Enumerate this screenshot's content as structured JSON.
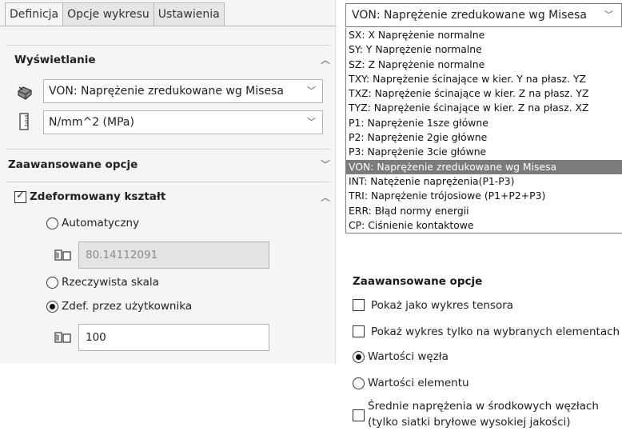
{
  "tabs": [
    "Definicja",
    "Opcje wykresu",
    "Ustawienia"
  ],
  "display": {
    "title": "Wyświetlanie",
    "component": "VON: Naprężenie zredukowane wg Misesa",
    "units": "N/mm^2 (MPa)"
  },
  "advanced_collapsed": {
    "title": "Zaawansowane opcje"
  },
  "deformed": {
    "title": "Zdeformowany kształt",
    "checked": true,
    "auto_label": "Automatyczny",
    "auto_value": "80.14112091",
    "true_scale_label": "Rzeczywista skala",
    "user_label": "Zdef. przez użytkownika",
    "user_value": "100"
  },
  "list": {
    "selected_display": "VON: Naprężenie zredukowane wg Misesa",
    "items": [
      "SX: X Naprężenie normalne",
      "SY: Y Naprężenie normalne",
      "SZ: Z Naprężenie normalne",
      "TXY: Naprężenie ścinające w kier. Y na płasz. YZ",
      "TXZ: Naprężenie ścinające w kier. Z na płasz. YZ",
      "TYZ: Naprężenie ścinające w kier. Z na płasz. XZ",
      "P1: Naprężenie 1sze główne",
      "P2: Naprężenie 2gie główne",
      "P3: Naprężenie 3cie główne",
      "VON: Naprężenie zredukowane wg Misesa",
      "INT: Natężenie naprężenia(P1-P3)",
      "TRI: Naprężenie trójosiowe (P1+P2+P3)",
      "ERR:   Błąd normy energii",
      "CP: Ciśnienie kontaktowe"
    ],
    "selected_index": 9
  },
  "advanced_options": {
    "title": "Zaawansowane opcje",
    "tensor_label": "Pokaż jako wykres tensora",
    "selected_only_label": "Pokaż wykres tylko na wybranych elementach",
    "node_values_label": "Wartości węzła",
    "element_values_label": "Wartości elementu",
    "average_label_1": "Średnie naprężenia w środkowych węzłach",
    "average_label_2": "(tylko siatki bryłowe wysokiej jakości)"
  },
  "colors": {
    "selected_bg": "#7b7b7b",
    "panel_bg": "#f5f5f5"
  }
}
